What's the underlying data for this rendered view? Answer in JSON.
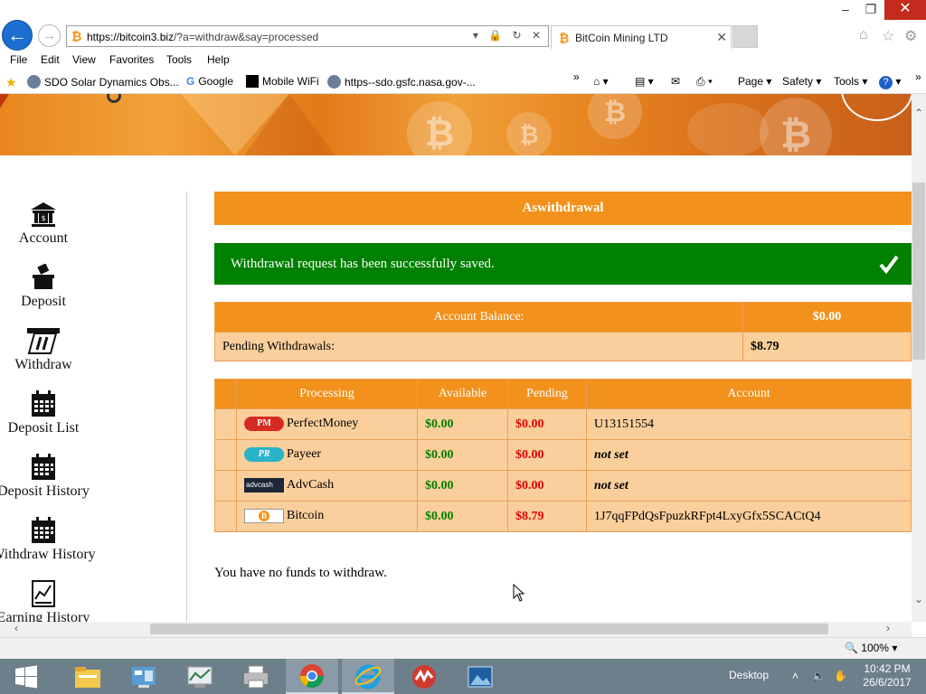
{
  "browser": {
    "address_scheme": "https://",
    "address_host": "bitcoin3.biz",
    "address_rest": "/?a=withdraw&say=processed",
    "tab_title": "BitCoin Mining LTD",
    "menu": [
      "File",
      "Edit",
      "View",
      "Favorites",
      "Tools",
      "Help"
    ],
    "favorites": [
      {
        "label": "SDO  Solar Dynamics Obs..."
      },
      {
        "label": "Google"
      },
      {
        "label": "Mobile WiFi"
      },
      {
        "label": "https--sdo.gsfc.nasa.gov-..."
      }
    ],
    "toolbar": {
      "page": "Page",
      "safety": "Safety",
      "tools": "Tools"
    },
    "zoom": "100%"
  },
  "sidebar": {
    "items": [
      {
        "label": "Account",
        "icon": "bank-icon"
      },
      {
        "label": "Deposit",
        "icon": "deposit-box-icon"
      },
      {
        "label": "Withdraw",
        "icon": "atm-card-icon"
      },
      {
        "label": "Deposit List",
        "icon": "calendar-icon"
      },
      {
        "label": "Deposit History",
        "icon": "calendar-icon"
      },
      {
        "label": "Withdraw History",
        "icon": "calendar-icon"
      },
      {
        "label": "Earning History",
        "icon": "chart-icon"
      }
    ]
  },
  "main": {
    "panel_title": "Aswithdrawal",
    "success_message": "Withdrawal request has been successfully saved.",
    "balance": {
      "label": "Account Balance:",
      "value": "$0.00",
      "pending_label": "Pending Withdrawals:",
      "pending_value": "$8.79"
    },
    "funds_table": {
      "headers": [
        "Processing",
        "Available",
        "Pending",
        "Account"
      ],
      "rows": [
        {
          "processor": "PerfectMoney",
          "badge": "PM",
          "available": "$0.00",
          "pending": "$0.00",
          "account": "U13151554"
        },
        {
          "processor": "Payeer",
          "badge": "PR",
          "available": "$0.00",
          "pending": "$0.00",
          "account": "not set"
        },
        {
          "processor": "AdvCash",
          "badge": "advcash",
          "available": "$0.00",
          "pending": "$0.00",
          "account": "not set"
        },
        {
          "processor": "Bitcoin",
          "badge": "B",
          "available": "$0.00",
          "pending": "$8.79",
          "account": "1J7qqFPdQsFpuzkRFpt4LxyGfx5SCACtQ4"
        }
      ]
    },
    "no_funds_message": "You have no funds to withdraw."
  },
  "taskbar": {
    "desktop_label": "Desktop",
    "time": "10:42 PM",
    "date": "26/6/2017"
  },
  "colors": {
    "orange": "#f2911b",
    "light_orange": "#fbcf9c",
    "success_green": "#008000",
    "pending_red": "#e00000"
  }
}
